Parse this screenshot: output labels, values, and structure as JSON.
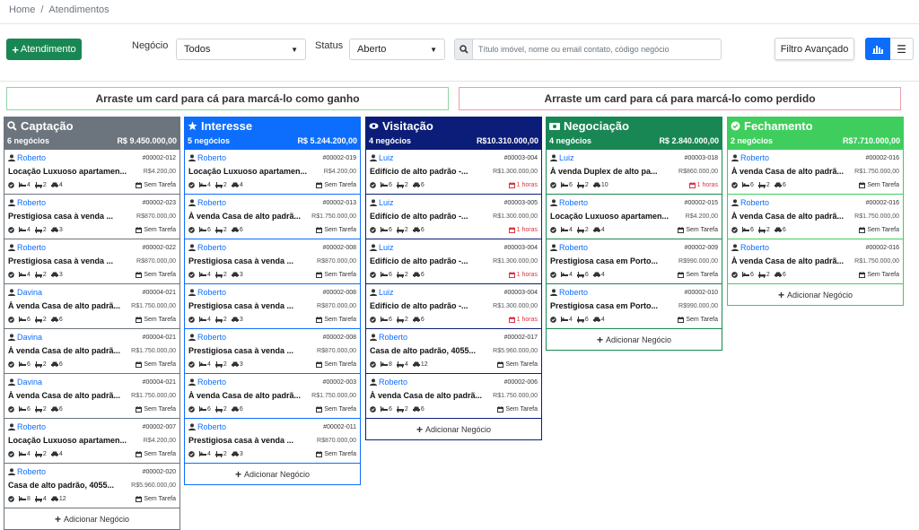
{
  "breadcrumb": {
    "home": "Home",
    "sep": "/",
    "current": "Atendimentos"
  },
  "toolbar": {
    "new_label": "Atendimento",
    "negocio_label": "Negócio",
    "negocio_value": "Todos",
    "status_label": "Status",
    "status_value": "Aberto",
    "search_placeholder": "Título imóvel, nome ou email contato, código negócio",
    "advanced_label": "Filtro Avançado"
  },
  "dropzones": {
    "win": "Arraste um card para cá para marcá-lo como ganho",
    "lose": "Arraste um card para cá para marcá-lo como perdido"
  },
  "add_label": "Adicionar Negócio",
  "columns": [
    {
      "title": "Captação",
      "icon": "search-icon",
      "count": "6 negócios",
      "total": "R$ 9.450.000,00",
      "color": "#6c757d",
      "cards": [
        {
          "name": "Roberto",
          "code": "#00002-012",
          "title": "Locação Luxuoso apartamen...",
          "price": "R$4.200,00",
          "f1": "4",
          "f2": "2",
          "f3": "4",
          "task": "Sem Tarefa",
          "late": false
        },
        {
          "name": "Roberto",
          "code": "#00002-023",
          "title": "Prestigiosa casa à venda ...",
          "price": "R$870.000,00",
          "f1": "4",
          "f2": "2",
          "f3": "3",
          "task": "Sem Tarefa",
          "late": false
        },
        {
          "name": "Roberto",
          "code": "#00002-022",
          "title": "Prestigiosa casa à venda ...",
          "price": "R$870.000,00",
          "f1": "4",
          "f2": "2",
          "f3": "3",
          "task": "Sem Tarefa",
          "late": false
        },
        {
          "name": "Davina",
          "code": "#00004-021",
          "title": "À venda Casa de alto padrã...",
          "price": "R$1.750.000,00",
          "f1": "6",
          "f2": "2",
          "f3": "6",
          "task": "Sem Tarefa",
          "late": false
        },
        {
          "name": "Davina",
          "code": "#00004-021",
          "title": "À venda Casa de alto padrã...",
          "price": "R$1.750.000,00",
          "f1": "6",
          "f2": "2",
          "f3": "6",
          "task": "Sem Tarefa",
          "late": false
        },
        {
          "name": "Davina",
          "code": "#00004-021",
          "title": "À venda Casa de alto padrã...",
          "price": "R$1.750.000,00",
          "f1": "6",
          "f2": "2",
          "f3": "6",
          "task": "Sem Tarefa",
          "late": false
        },
        {
          "name": "Roberto",
          "code": "#00002-007",
          "title": "Locação Luxuoso apartamen...",
          "price": "R$4.200,00",
          "f1": "4",
          "f2": "2",
          "f3": "4",
          "task": "Sem Tarefa",
          "late": false
        },
        {
          "name": "Roberto",
          "code": "#00002-020",
          "title": "Casa de alto padrão, 4055...",
          "price": "R$5.960.000,00",
          "f1": "8",
          "f2": "4",
          "f3": "12",
          "task": "Sem Tarefa",
          "late": false
        }
      ]
    },
    {
      "title": "Interesse",
      "icon": "star-icon",
      "count": "5 negócios",
      "total": "R$ 5.244.200,00",
      "color": "#0d6efd",
      "cards": [
        {
          "name": "Roberto",
          "code": "#00002-019",
          "title": "Locação Luxuoso apartamen...",
          "price": "R$4.200,00",
          "f1": "4",
          "f2": "2",
          "f3": "4",
          "task": "Sem Tarefa",
          "late": false
        },
        {
          "name": "Roberto",
          "code": "#00002-013",
          "title": "À venda Casa de alto padrã...",
          "price": "R$1.750.000,00",
          "f1": "6",
          "f2": "2",
          "f3": "6",
          "task": "Sem Tarefa",
          "late": false
        },
        {
          "name": "Roberto",
          "code": "#00002-008",
          "title": "Prestigiosa casa à venda ...",
          "price": "R$870.000,00",
          "f1": "4",
          "f2": "2",
          "f3": "3",
          "task": "Sem Tarefa",
          "late": false
        },
        {
          "name": "Roberto",
          "code": "#00002-008",
          "title": "Prestigiosa casa à venda ...",
          "price": "R$870.000,00",
          "f1": "4",
          "f2": "2",
          "f3": "3",
          "task": "Sem Tarefa",
          "late": false
        },
        {
          "name": "Roberto",
          "code": "#00002-008",
          "title": "Prestigiosa casa à venda ...",
          "price": "R$870.000,00",
          "f1": "4",
          "f2": "2",
          "f3": "3",
          "task": "Sem Tarefa",
          "late": false
        },
        {
          "name": "Roberto",
          "code": "#00002-003",
          "title": "À venda Casa de alto padrã...",
          "price": "R$1.750.000,00",
          "f1": "6",
          "f2": "2",
          "f3": "6",
          "task": "Sem Tarefa",
          "late": false
        },
        {
          "name": "Roberto",
          "code": "#00002-011",
          "title": "Prestigiosa casa à venda ...",
          "price": "R$870.000,00",
          "f1": "4",
          "f2": "2",
          "f3": "3",
          "task": "Sem Tarefa",
          "late": false
        }
      ]
    },
    {
      "title": "Visitação",
      "icon": "eye-icon",
      "count": "4 negócios",
      "total": "R$10.310.000,00",
      "color": "#0b1d78",
      "cards": [
        {
          "name": "Luiz",
          "code": "#00003-004",
          "title": "Edifício de alto padrão -...",
          "price": "R$1.300.000,00",
          "f1": "6",
          "f2": "2",
          "f3": "6",
          "task": "1 horas",
          "late": true
        },
        {
          "name": "Luiz",
          "code": "#00003-005",
          "title": "Edifício de alto padrão -...",
          "price": "R$1.300.000,00",
          "f1": "6",
          "f2": "2",
          "f3": "6",
          "task": "1 horas",
          "late": true
        },
        {
          "name": "Luiz",
          "code": "#00003-004",
          "title": "Edifício de alto padrão -...",
          "price": "R$1.300.000,00",
          "f1": "6",
          "f2": "2",
          "f3": "6",
          "task": "1 horas",
          "late": true
        },
        {
          "name": "Luiz",
          "code": "#00003-004",
          "title": "Edifício de alto padrão -...",
          "price": "R$1.300.000,00",
          "f1": "6",
          "f2": "2",
          "f3": "6",
          "task": "1 horas",
          "late": true
        },
        {
          "name": "Roberto",
          "code": "#00002-017",
          "title": "Casa de alto padrão, 4055...",
          "price": "R$5.960.000,00",
          "f1": "8",
          "f2": "4",
          "f3": "12",
          "task": "Sem Tarefa",
          "late": false
        },
        {
          "name": "Roberto",
          "code": "#00002-006",
          "title": "À venda Casa de alto padrã...",
          "price": "R$1.750.000,00",
          "f1": "6",
          "f2": "2",
          "f3": "6",
          "task": "Sem Tarefa",
          "late": false
        }
      ]
    },
    {
      "title": "Negociação",
      "icon": "money-icon",
      "count": "4 negócios",
      "total": "R$ 2.840.000,00",
      "color": "#198754",
      "cards": [
        {
          "name": "Luiz",
          "code": "#00003-018",
          "title": "À venda Duplex de alto pa...",
          "price": "R$860.000,00",
          "f1": "6",
          "f2": "2",
          "f3": "10",
          "task": "1 horas",
          "late": true
        },
        {
          "name": "Roberto",
          "code": "#00002-015",
          "title": "Locação Luxuoso apartamen...",
          "price": "R$4.200,00",
          "f1": "4",
          "f2": "2",
          "f3": "4",
          "task": "Sem Tarefa",
          "late": false
        },
        {
          "name": "Roberto",
          "code": "#00002-009",
          "title": "Prestigiosa casa em Porto...",
          "price": "R$990.000,00",
          "f1": "4",
          "f2": "6",
          "f3": "4",
          "task": "Sem Tarefa",
          "late": false
        },
        {
          "name": "Roberto",
          "code": "#00002-010",
          "title": "Prestigiosa casa em Porto...",
          "price": "R$990.000,00",
          "f1": "4",
          "f2": "6",
          "f3": "4",
          "task": "Sem Tarefa",
          "late": false
        }
      ]
    },
    {
      "title": "Fechamento",
      "icon": "check-circle-icon",
      "count": "2 negócios",
      "total": "R$7.710.000,00",
      "color": "#3fce5d",
      "cards": [
        {
          "name": "Roberto",
          "code": "#00002-016",
          "title": "À venda Casa de alto padrã...",
          "price": "R$1.750.000,00",
          "f1": "6",
          "f2": "2",
          "f3": "6",
          "task": "Sem Tarefa",
          "late": false
        },
        {
          "name": "Roberto",
          "code": "#00002-016",
          "title": "À venda Casa de alto padrã...",
          "price": "R$1.750.000,00",
          "f1": "6",
          "f2": "2",
          "f3": "6",
          "task": "Sem Tarefa",
          "late": false
        },
        {
          "name": "Roberto",
          "code": "#00002-016",
          "title": "À venda Casa de alto padrã...",
          "price": "R$1.750.000,00",
          "f1": "6",
          "f2": "2",
          "f3": "6",
          "task": "Sem Tarefa",
          "late": false
        }
      ]
    }
  ]
}
